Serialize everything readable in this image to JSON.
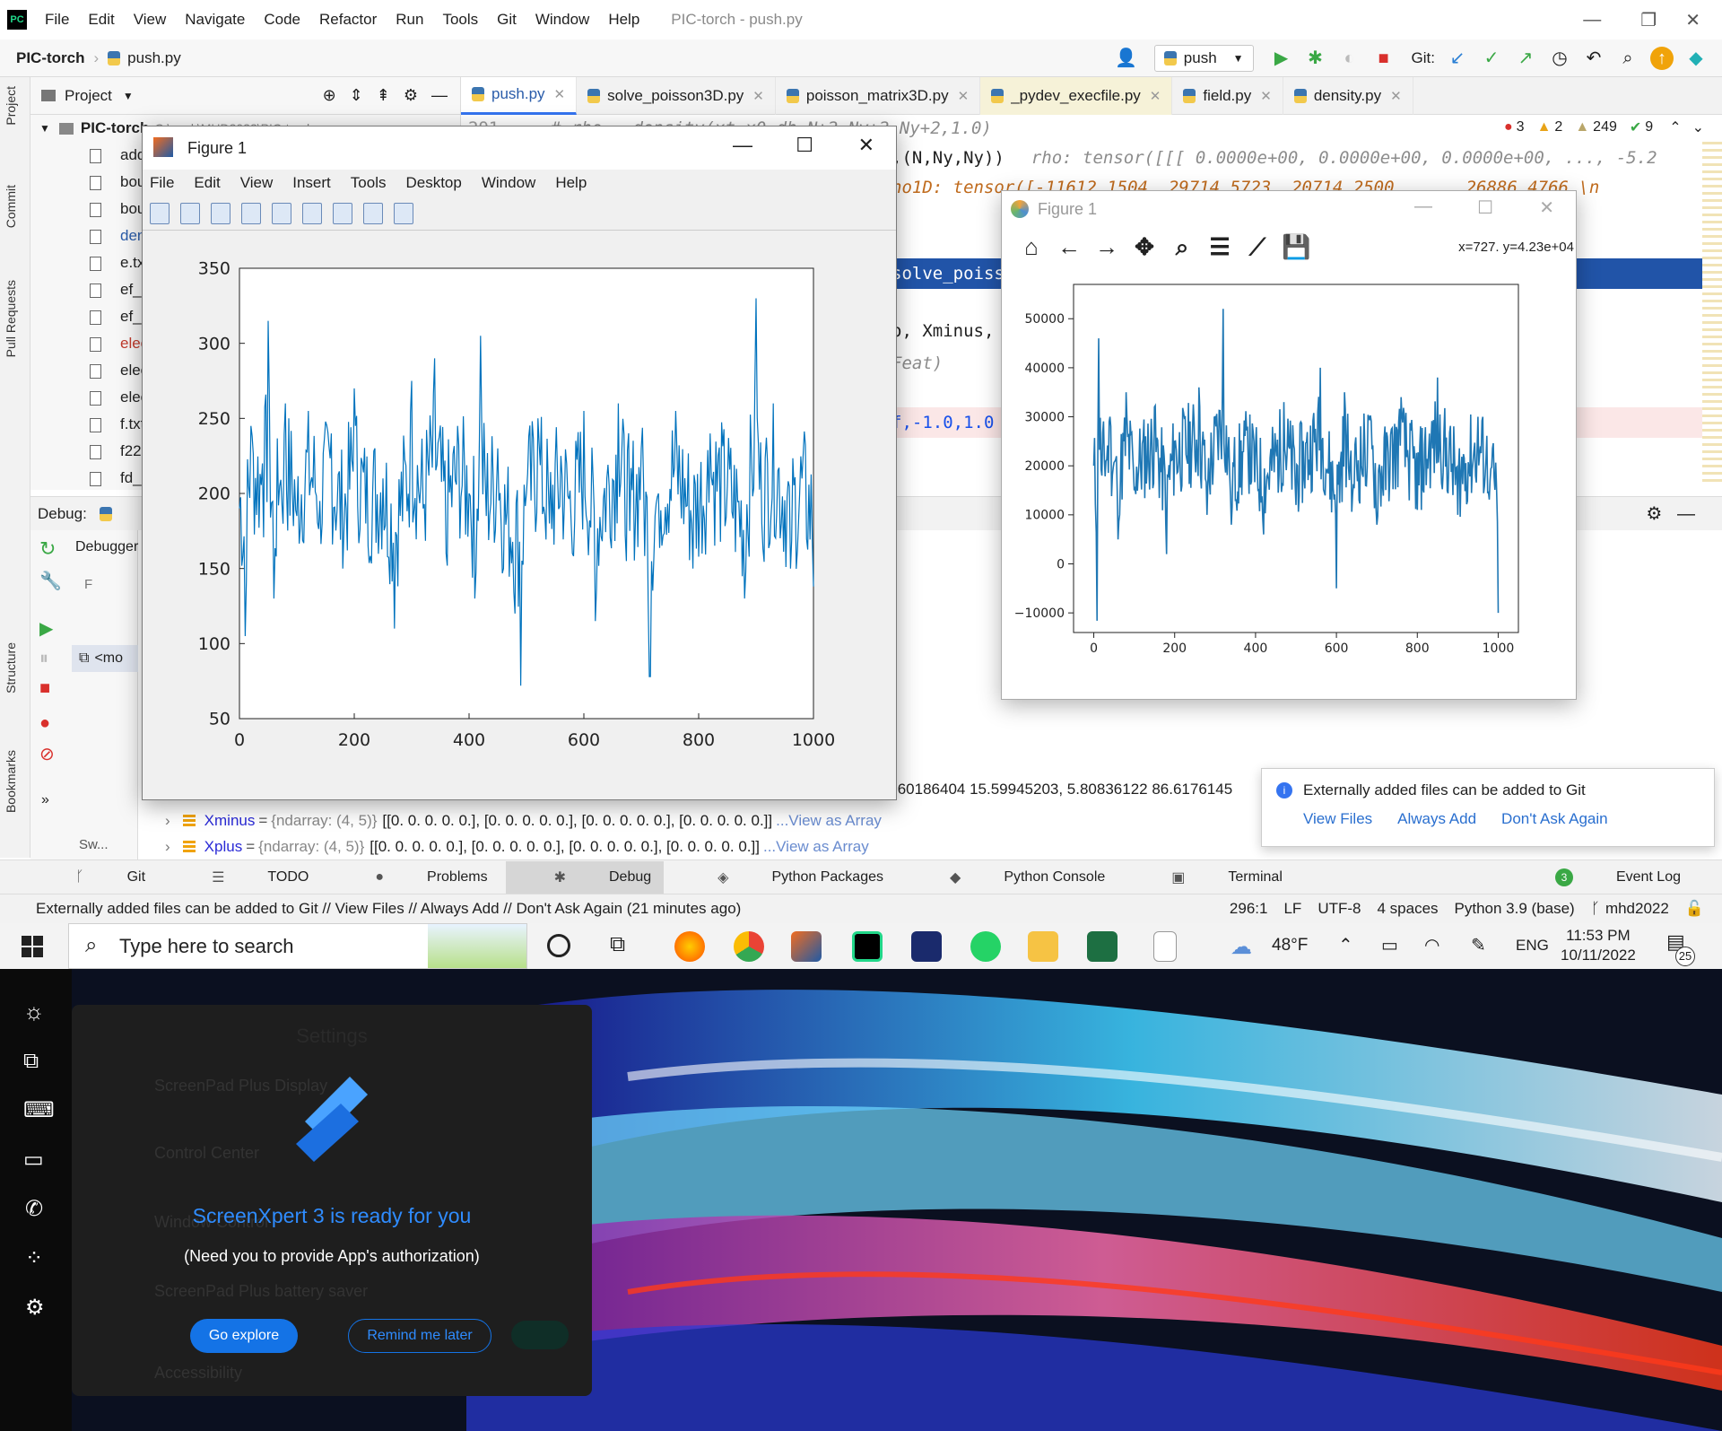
{
  "app": {
    "menu": [
      "File",
      "Edit",
      "View",
      "Navigate",
      "Code",
      "Refactor",
      "Run",
      "Tools",
      "Git",
      "Window",
      "Help"
    ],
    "window_title": "PIC-torch - push.py",
    "breadcrumb_project": "PIC-torch",
    "breadcrumb_file": "push.py",
    "run_config": "push",
    "git_label": "Git:"
  },
  "left_strip": [
    "Project",
    "Commit",
    "Pull Requests",
    "Structure",
    "Bookmarks"
  ],
  "project_panel": {
    "title": "Project",
    "root": "PIC-torch",
    "root_path": "C:\\work\\MHD2022\\PIC-torch",
    "items": [
      "add",
      "bou",
      "bou",
      "dens",
      "e.txt",
      "ef_4",
      "ef_p",
      "elect",
      "elect",
      "elect",
      "f.txt",
      "f22.c",
      "fd_2"
    ]
  },
  "tabs": [
    "push.py",
    "solve_poisson3D.py",
    "poisson_matrix3D.py",
    "_pydev_execfile.py",
    "field.py",
    "density.py"
  ],
  "inspections": {
    "errors": "3",
    "warnings": "2",
    "weak": "249",
    "ok": "9"
  },
  "code_lines": {
    "l1_num": "291",
    "l1": "# rho = density(xt,x0,dh,N+2,Ny+2,Ny+2,1.0)",
    "l2": ",(N,Ny,Ny))",
    "l2_hint": "rho: tensor([[[ 0.0000e+00,  0.0000e+00,  0.0000e+00,  ..., -5.2",
    "l3": "ho1D: tensor([-11612.1504,  29714.5723,  20714.2500,  ...,  26886.4766,\\n",
    "l4": "solve_poiss",
    "l5": "o, Xminus,",
    "l6": "Feat)",
    "l7": "f,-1.0,1.0"
  },
  "debug": {
    "label": "Debug:",
    "debugger_tab": "Debugger",
    "frame": "F",
    "thread_item": "<mo",
    "sw": "Sw..."
  },
  "variables": [
    {
      "name": "Xminus",
      "type": "{ndarray: (4, 5)}",
      "value": "[[0. 0. 0. 0. 0.], [0. 0. 0. 0. 0.], [0. 0. 0. 0. 0.], [0. 0. 0. 0. 0.]]",
      "link": "...View as Array"
    },
    {
      "name": "Xplus",
      "type": "{ndarray: (4, 5)}",
      "value": "[[0. 0. 0. 0. 0.], [0. 0. 0. 0. 0.], [0. 0. 0. 0. 0.], [0. 0. 0. 0. 0.]]",
      "link": "...View as Array"
    }
  ],
  "partial_value": ".60186404 15.59945203,  5.80836122 86.6176145",
  "bottom_tools": [
    "Git",
    "TODO",
    "Problems",
    "Debug",
    "Python Packages",
    "Python Console",
    "Terminal"
  ],
  "event_log": "Event Log",
  "event_count": "3",
  "status": {
    "message": "Externally added files can be added to Git // View Files // Always Add // Don't Ask Again (21 minutes ago)",
    "position": "296:1",
    "line_sep": "LF",
    "encoding": "UTF-8",
    "indent": "4 spaces",
    "interpreter": "Python 3.9 (base)",
    "branch": "mhd2022"
  },
  "git_popup": {
    "message": "Externally added files can be added to Git",
    "actions": [
      "View Files",
      "Always Add",
      "Don't Ask Again"
    ]
  },
  "matlab_figure": {
    "title": "Figure 1",
    "menu": [
      "File",
      "Edit",
      "View",
      "Insert",
      "Tools",
      "Desktop",
      "Window",
      "Help"
    ]
  },
  "mpl_figure": {
    "title": "Figure 1",
    "coords": "x=727. y=4.23e+04"
  },
  "chart_data": [
    {
      "type": "line",
      "title": "",
      "xlabel": "",
      "ylabel": "",
      "xlim": [
        0,
        1000
      ],
      "ylim": [
        50,
        350
      ],
      "xticks": [
        0,
        200,
        400,
        600,
        800,
        1000
      ],
      "yticks": [
        50,
        100,
        150,
        200,
        250,
        300,
        350
      ],
      "color": "#0072bd",
      "series": [
        {
          "points": [
            [
              0,
              190
            ],
            [
              10,
              105
            ],
            [
              20,
              245
            ],
            [
              40,
              220
            ],
            [
              50,
              315
            ],
            [
              60,
              130
            ],
            [
              70,
              205
            ],
            [
              80,
              260
            ],
            [
              100,
              185
            ],
            [
              120,
              255
            ],
            [
              140,
              195
            ],
            [
              160,
              240
            ],
            [
              180,
              150
            ],
            [
              200,
              270
            ],
            [
              220,
              180
            ],
            [
              250,
              210
            ],
            [
              270,
              110
            ],
            [
              300,
              275
            ],
            [
              320,
              190
            ],
            [
              340,
              290
            ],
            [
              360,
              160
            ],
            [
              380,
              245
            ],
            [
              400,
              200
            ],
            [
              410,
              130
            ],
            [
              420,
              305
            ],
            [
              430,
              185
            ],
            [
              450,
              230
            ],
            [
              460,
              150
            ],
            [
              480,
              120
            ],
            [
              490,
              72
            ],
            [
              500,
              200
            ],
            [
              520,
              250
            ],
            [
              540,
              180
            ],
            [
              560,
              225
            ],
            [
              580,
              160
            ],
            [
              600,
              255
            ],
            [
              620,
              115
            ],
            [
              640,
              210
            ],
            [
              660,
              260
            ],
            [
              680,
              175
            ],
            [
              700,
              230
            ],
            [
              715,
              78
            ],
            [
              730,
              200
            ],
            [
              760,
              255
            ],
            [
              790,
              150
            ],
            [
              820,
              240
            ],
            [
              850,
              205
            ],
            [
              880,
              130
            ],
            [
              900,
              330
            ],
            [
              910,
              180
            ],
            [
              930,
              260
            ],
            [
              960,
              150
            ],
            [
              980,
              210
            ],
            [
              1000,
              138
            ]
          ]
        }
      ],
      "grid": false
    },
    {
      "type": "line",
      "title": "",
      "xlabel": "",
      "ylabel": "",
      "xlim": [
        -50,
        1050
      ],
      "ylim": [
        -14000,
        57000
      ],
      "xticks": [
        0,
        200,
        400,
        600,
        800,
        1000
      ],
      "yticks": [
        -10000,
        0,
        10000,
        20000,
        30000,
        40000,
        50000
      ],
      "color": "#1f77b4",
      "series": [
        {
          "points": [
            [
              0,
              20000
            ],
            [
              8,
              -11600
            ],
            [
              12,
              46000
            ],
            [
              20,
              18000
            ],
            [
              40,
              30000
            ],
            [
              60,
              5000
            ],
            [
              80,
              35000
            ],
            [
              100,
              15000
            ],
            [
              150,
              32000
            ],
            [
              180,
              2000
            ],
            [
              200,
              25000
            ],
            [
              260,
              36000
            ],
            [
              280,
              10000
            ],
            [
              300,
              30000
            ],
            [
              320,
              52000
            ],
            [
              340,
              8000
            ],
            [
              380,
              28000
            ],
            [
              420,
              6000
            ],
            [
              470,
              33000
            ],
            [
              500,
              12000
            ],
            [
              560,
              40000
            ],
            [
              600,
              -5000
            ],
            [
              620,
              35000
            ],
            [
              640,
              14000
            ],
            [
              680,
              30000
            ],
            [
              700,
              8000
            ],
            [
              760,
              34000
            ],
            [
              800,
              11000
            ],
            [
              850,
              38000
            ],
            [
              900,
              10000
            ],
            [
              950,
              30000
            ],
            [
              980,
              17000
            ],
            [
              1000,
              -10000
            ]
          ]
        }
      ],
      "grid": false
    }
  ],
  "taskbar": {
    "search_placeholder": "Type here to search",
    "weather": "48°F",
    "lang": "ENG",
    "time": "11:53 PM",
    "date": "10/11/2022",
    "notif": "25"
  },
  "screenpad": {
    "settings_title": "Settings",
    "setting_rows": [
      "ScreenPad Plus Display",
      "Control Center",
      "Window Control",
      "ScreenPad Plus battery saver",
      "Accessibility"
    ],
    "headline": "ScreenXpert 3 is ready for you",
    "subtext": "(Need you to provide App's authorization)",
    "go": "Go explore",
    "remind": "Remind me later"
  }
}
